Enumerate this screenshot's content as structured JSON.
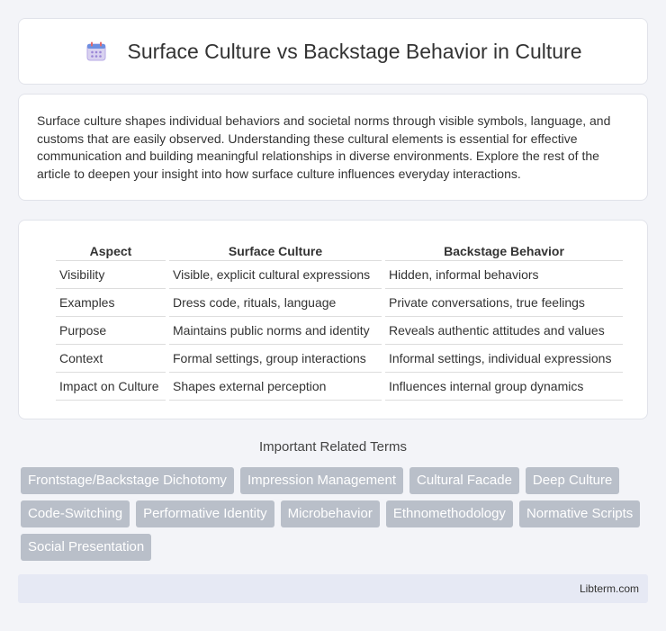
{
  "header": {
    "title": "Surface Culture vs Backstage Behavior in Culture",
    "icon": "calendar-icon"
  },
  "intro": {
    "text": "Surface culture shapes individual behaviors and societal norms through visible symbols, language, and customs that are easily observed. Understanding these cultural elements is essential for effective communication and building meaningful relationships in diverse environments. Explore the rest of the article to deepen your insight into how surface culture influences everyday interactions."
  },
  "table": {
    "headers": [
      "Aspect",
      "Surface Culture",
      "Backstage Behavior"
    ],
    "rows": [
      [
        "Visibility",
        "Visible, explicit cultural expressions",
        "Hidden, informal behaviors"
      ],
      [
        "Examples",
        "Dress code, rituals, language",
        "Private conversations, true feelings"
      ],
      [
        "Purpose",
        "Maintains public norms and identity",
        "Reveals authentic attitudes and values"
      ],
      [
        "Context",
        "Formal settings, group interactions",
        "Informal settings, individual expressions"
      ],
      [
        "Impact on Culture",
        "Shapes external perception",
        "Influences internal group dynamics"
      ]
    ]
  },
  "related": {
    "title": "Important Related Terms",
    "terms": [
      "Frontstage/Backstage Dichotomy",
      "Impression Management",
      "Cultural Facade",
      "Deep Culture",
      "Code-Switching",
      "Performative Identity",
      "Microbehavior",
      "Ethnomethodology",
      "Normative Scripts",
      "Social Presentation"
    ]
  },
  "footer": {
    "text": "Libterm.com"
  },
  "colors": {
    "background": "#f3f4f8",
    "tag": "#b9bfc9",
    "footer": "#e6e9f4"
  }
}
